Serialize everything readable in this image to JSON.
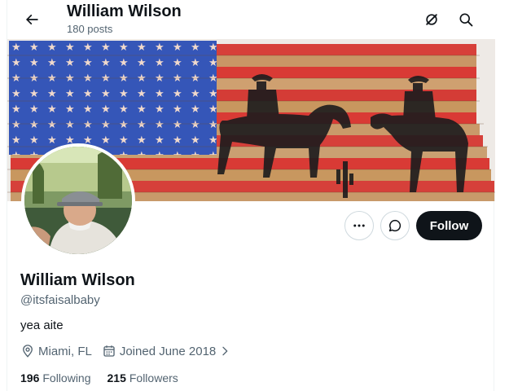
{
  "header": {
    "title": "William Wilson",
    "post_count": "180 posts"
  },
  "icons": {
    "back": "arrow-left-icon",
    "grok": "grok-icon",
    "search": "search-icon",
    "more": "more-icon",
    "message": "message-icon",
    "location": "location-pin-icon",
    "calendar": "calendar-icon",
    "chevron": "chevron-right-icon"
  },
  "profile": {
    "name": "William Wilson",
    "handle": "@itsfaisalbaby",
    "bio": "yea aite",
    "location": "Miami, FL",
    "joined": "Joined June 2018",
    "following_count": "196",
    "following_label": "Following",
    "followers_count": "215",
    "followers_label": "Followers"
  },
  "actions": {
    "follow_label": "Follow"
  },
  "colors": {
    "text_primary": "#0f1419",
    "text_secondary": "#536471",
    "border": "#cfd9de",
    "follow_bg": "#0f1419",
    "flag_blue": "#3556b8",
    "flag_red": "#d93a35",
    "wood": "#c89a6a"
  }
}
